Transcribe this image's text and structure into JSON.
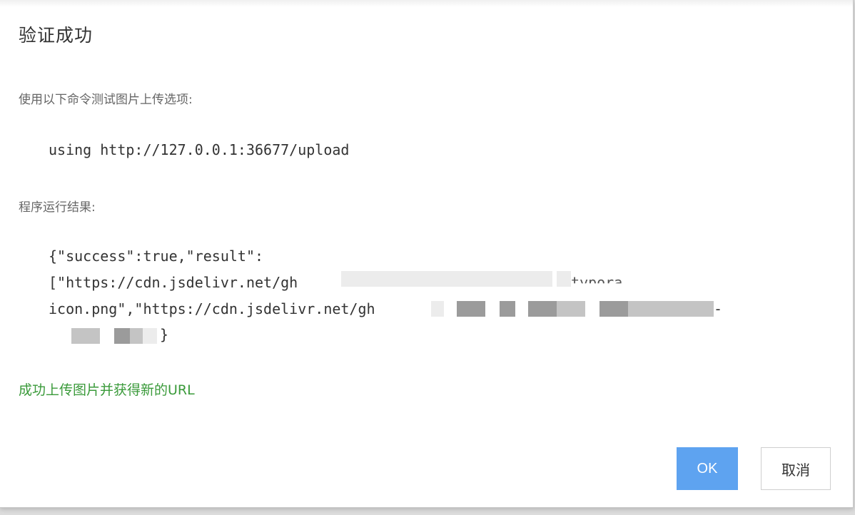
{
  "dialog": {
    "title": "验证成功",
    "instruction_label": "使用以下命令测试图片上传选项:",
    "command": "using http://127.0.0.1:36677/upload",
    "result_label": "程序运行结果:",
    "result_lines": [
      "{\"success\":true,\"result\":",
      "[\"https://cdn.jsdelivr.net/gh",
      "icon.png\",\"https://cdn.jsdelivr.net/gh",
      "}"
    ],
    "result_fragment_typora": "typora",
    "result_dash": "-",
    "success_message": "成功上传图片并获得新的URL",
    "ok_label": "OK",
    "cancel_label": "取消"
  },
  "colors": {
    "success_text": "#3a9a3a",
    "primary_button": "#5ea3f0"
  }
}
